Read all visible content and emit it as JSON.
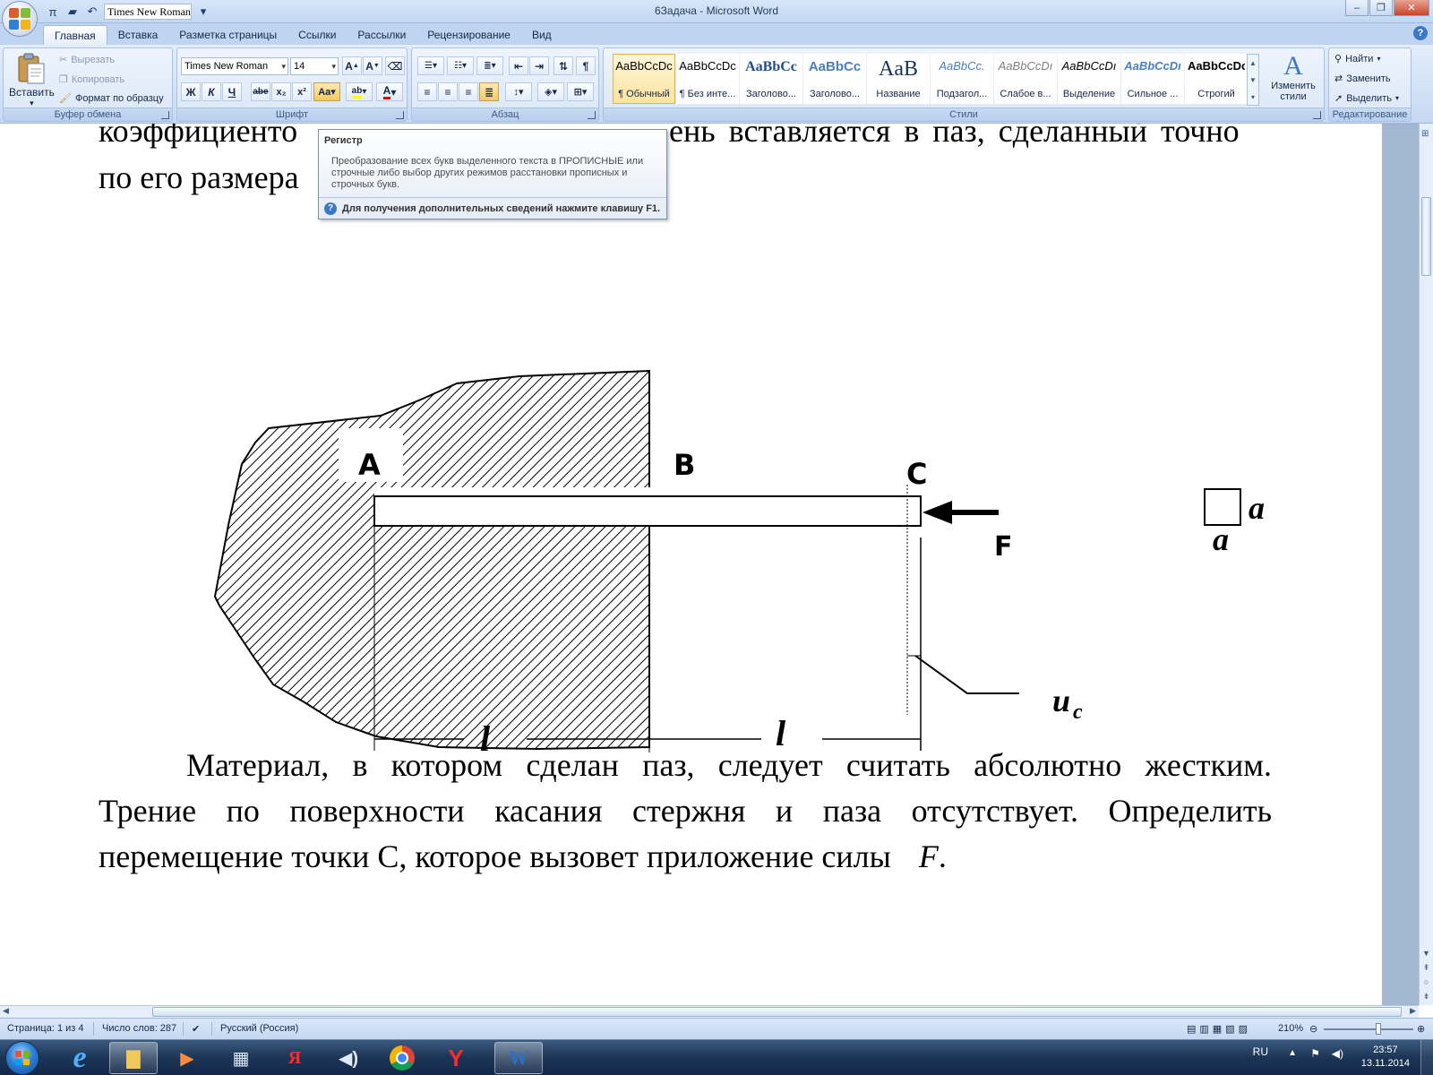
{
  "window": {
    "title": "6Задача - Microsoft Word",
    "qat_font": "Times New Roman"
  },
  "tabs": [
    "Главная",
    "Вставка",
    "Разметка страницы",
    "Ссылки",
    "Рассылки",
    "Рецензирование",
    "Вид"
  ],
  "ribbon": {
    "clipboard": {
      "label": "Буфер обмена",
      "paste": "Вставить",
      "cut": "Вырезать",
      "copy": "Копировать",
      "format_painter": "Формат по образцу"
    },
    "font": {
      "label": "Шрифт",
      "font_name": "Times New Roman",
      "font_size": "14"
    },
    "paragraph": {
      "label": "Абзац"
    },
    "styles": {
      "label": "Стили",
      "items": [
        {
          "sample": "AaBbCcDc",
          "name": "¶ Обычный"
        },
        {
          "sample": "AaBbCcDc",
          "name": "¶ Без инте..."
        },
        {
          "sample": "AaBbCc",
          "name": "Заголово..."
        },
        {
          "sample": "AaBbCc",
          "name": "Заголово..."
        },
        {
          "sample": "AaB",
          "name": "Название"
        },
        {
          "sample": "AaBbCc.",
          "name": "Подзагол..."
        },
        {
          "sample": "AaBbCcDı",
          "name": "Слабое в..."
        },
        {
          "sample": "AaBbCcDı",
          "name": "Выделение"
        },
        {
          "sample": "AaBbCcDı",
          "name": "Сильное ..."
        },
        {
          "sample": "AaBbCcDc",
          "name": "Строгий"
        }
      ],
      "change_styles": "Изменить стили"
    },
    "editing": {
      "label": "Редактирование",
      "find": "Найти",
      "replace": "Заменить",
      "select": "Выделить"
    }
  },
  "tooltip": {
    "title": "Регистр",
    "body": "Преобразование всех букв выделенного текста в ПРОПИСНЫЕ или строчные либо выбор других режимов расстановки прописных и строчных букв.",
    "footer": "Для получения дополнительных сведений нажмите клавишу F1."
  },
  "document": {
    "line_top1": "коэффициенто",
    "line_top1_right": "ень вставляется в паз, сделанный точно",
    "line_top2": "по его размера",
    "figure": {
      "label_A": "A",
      "label_B": "B",
      "label_C": "C",
      "label_F": "F",
      "label_l1": "l",
      "label_l2": "l",
      "label_u": "u",
      "label_u_sub": "c",
      "label_a1": "a",
      "label_a2": "a"
    },
    "para_line1": "Материал, в котором сделан паз, следует считать абсолютно жестким.",
    "para_line2": "Трение по поверхности касания стержня и паза отсутствует. Определить",
    "para_line3_start": "перемещение точки  С, которое вызовет приложение силы  ",
    "para_line3_var": "F",
    "para_line3_end": "."
  },
  "status": {
    "page": "Страница: 1 из 4",
    "words": "Число слов: 287",
    "language": "Русский (Россия)",
    "zoom": "210%"
  },
  "taskbar": {
    "lang": "RU",
    "time": "23:57",
    "date": "13.11.2014"
  },
  "colors": {
    "ribbon_bg": "#d2e1f5",
    "doc_bg": "#a1b7d2",
    "taskbar": "#1c3556",
    "accent": "#3b78c6"
  }
}
